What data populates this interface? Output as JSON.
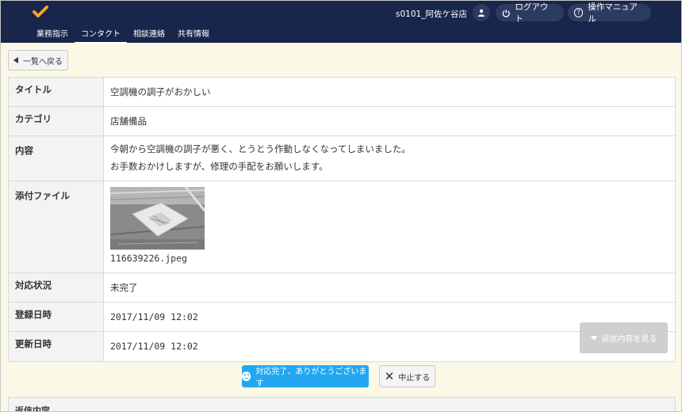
{
  "header": {
    "store_name": "s0101_阿佐ケ谷店",
    "logout_label": "ログアウト",
    "manual_label": "操作マニュアル",
    "nav": [
      {
        "label": "業務指示"
      },
      {
        "label": "コンタクト"
      },
      {
        "label": "相談連絡"
      },
      {
        "label": "共有情報"
      }
    ],
    "active_nav": "コンタクト",
    "brand_color": "#17264a",
    "logo_color": "#f5a623"
  },
  "back_button": {
    "label": "一覧へ戻る"
  },
  "detail": {
    "title_label": "タイトル",
    "title_value": "空調機の調子がおかしい",
    "category_label": "カテゴリ",
    "category_value": "店舗備品",
    "content_label": "内容",
    "content_line1": "今朝から空調機の調子が悪く、とうとう作動しなくなってしまいました。",
    "content_line2": "お手数おかけしますが、修理の手配をお願いします。",
    "attachment_label": "添付ファイル",
    "attachment_filename": "116639226.jpeg",
    "status_label": "対応状況",
    "status_value": "未完了",
    "registered_label": "登録日時",
    "registered_value": "2017/11/09 12:02",
    "updated_label": "更新日時",
    "updated_value": "2017/11/09 12:02"
  },
  "reply_view_button": {
    "label": "返信内容を見る"
  },
  "actions": {
    "complete_label": "対応完了、ありがとうございます",
    "stop_label": "中止する",
    "complete_color": "#22a7f0"
  },
  "reply_section": {
    "title": "返信内容"
  }
}
